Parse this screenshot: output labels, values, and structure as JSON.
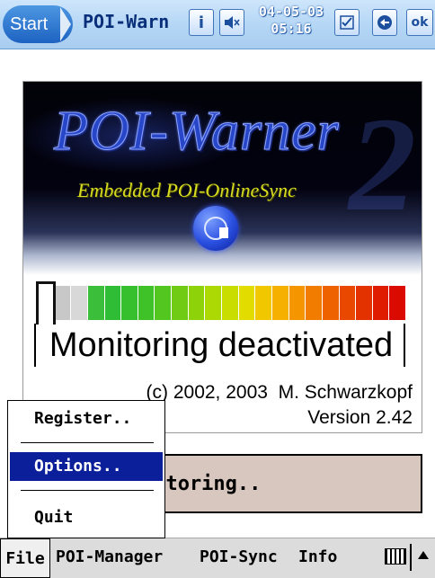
{
  "taskbar": {
    "start_label": "Start",
    "app_title": "POI-Warn",
    "clock_date": "04-05-03",
    "clock_time": "05:16",
    "info_glyph": "i",
    "ok_label": "ok"
  },
  "splash": {
    "title": "POI-Warner",
    "big_digit": "2",
    "subtitle": "Embedded POI-OnlineSync",
    "status_text": "Monitoring deactivated",
    "copyright": "(c) 2002, 2003  M. Schwarzkopf",
    "version": "Version 2.42",
    "meter_colors": [
      "#ffffff",
      "#c8c8c8",
      "#d8d8d8",
      "#3bbf3b",
      "#2fbd35",
      "#37c02d",
      "#3fc228",
      "#53c61f",
      "#6fcb13",
      "#8ed20a",
      "#acd803",
      "#c9dd00",
      "#e3dc00",
      "#f1c800",
      "#f5b000",
      "#f59600",
      "#f27c00",
      "#ee6200",
      "#e94800",
      "#e43100",
      "#df1b00",
      "#da0a00"
    ]
  },
  "main": {
    "start_monitoring_label": "Start monitoring.."
  },
  "file_menu": {
    "items": [
      {
        "label": "Register.."
      },
      {
        "label": "Options..",
        "selected": true
      },
      {
        "label": "Quit"
      }
    ]
  },
  "menubar": {
    "items": [
      "File",
      "POI-Manager",
      "POI-Sync",
      "Info"
    ]
  },
  "icons": {
    "start": "windows-flag",
    "keyboard": "keyboard-icon",
    "sip_arrow": "up-arrow-icon"
  },
  "colors": {
    "taskbar": "#b7d8f6",
    "selection": "#0b1f9a",
    "button_bg": "#d8c7bf"
  }
}
